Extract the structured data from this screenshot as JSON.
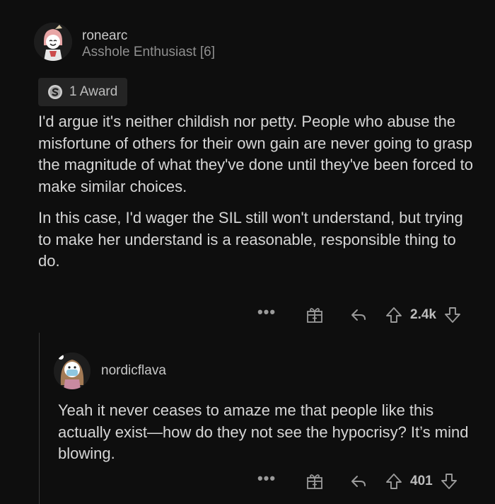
{
  "comments": [
    {
      "username": "ronearc",
      "flair": "Asshole Enthusiast [6]",
      "award_label": "1 Award",
      "paragraphs": [
        "I'd argue it's neither childish nor petty. People who abuse the misfortune of others for their own gain are never going to grasp the magnitude of what they've done until they've been forced to make similar choices.",
        "In this case, I'd wager the SIL still won't understand, but trying to make her understand is a reasonable, responsible thing to do."
      ],
      "more_label": "•••",
      "score": "2.4k"
    },
    {
      "username": "nordicflava",
      "paragraphs": [
        "Yeah it never ceases to amaze me that people like this actually exist—how do they not see the hypocrisy? It’s mind blowing."
      ],
      "more_label": "•••",
      "score": "401"
    }
  ],
  "colors": {
    "background": "#0e0e0e",
    "text": "#d6d6d6",
    "muted": "#8f8f8f",
    "award_bg": "#242424"
  },
  "icons": [
    "silver-award-icon",
    "gift-icon",
    "reply-arrow-icon",
    "upvote-arrow-icon",
    "downvote-arrow-icon"
  ]
}
